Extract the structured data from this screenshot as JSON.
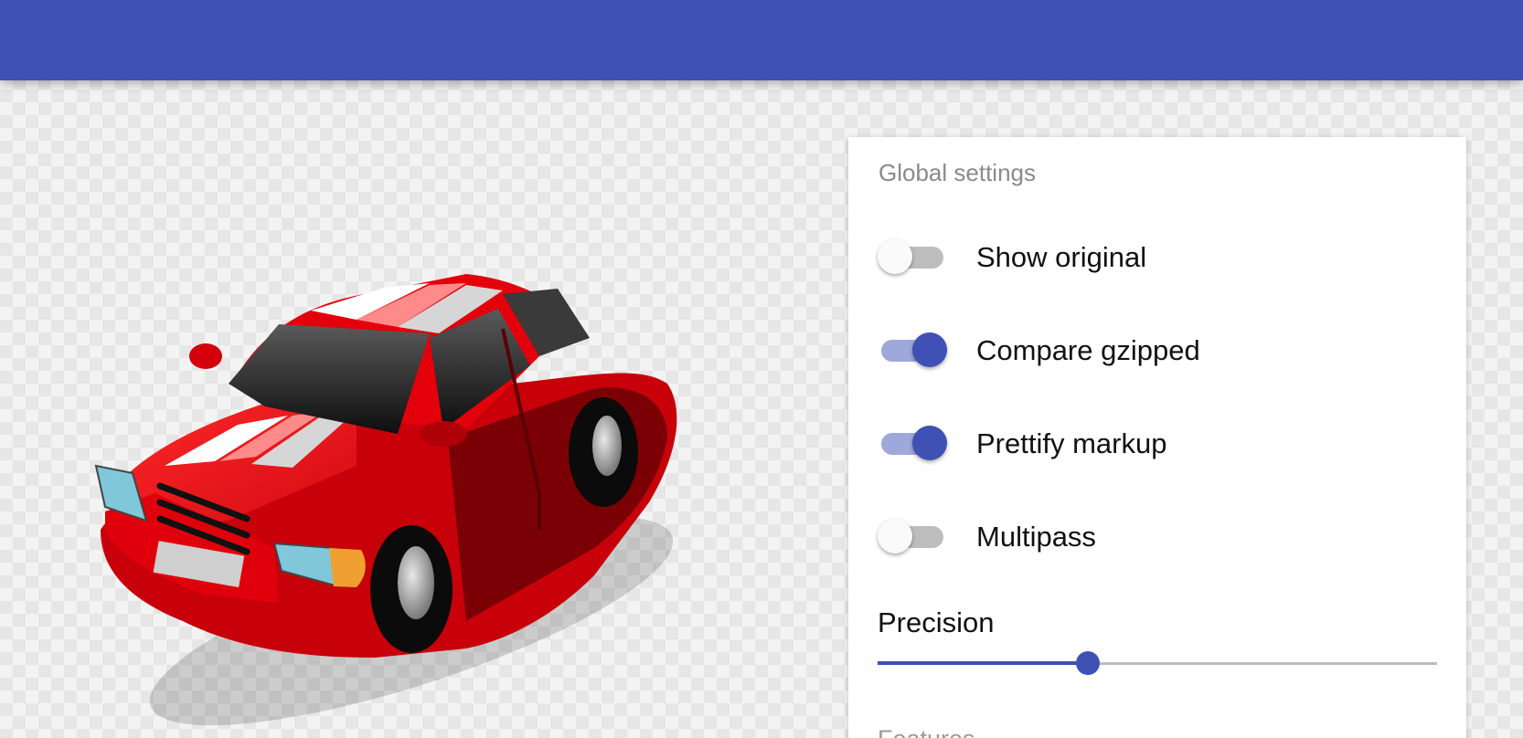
{
  "colors": {
    "primary": "#3f51b5",
    "primary_light": "#9fa8da",
    "toggle_off_track": "#bdbdbd",
    "toggle_off_thumb": "#fafafa"
  },
  "preview": {
    "image_icon": "red-car-illustration"
  },
  "settings": {
    "title": "Global settings",
    "options": [
      {
        "label": "Show original",
        "enabled": false
      },
      {
        "label": "Compare gzipped",
        "enabled": true
      },
      {
        "label": "Prettify markup",
        "enabled": true
      },
      {
        "label": "Multipass",
        "enabled": false
      }
    ],
    "precision": {
      "label": "Precision",
      "fraction": 0.375
    },
    "next_section_label": "Features"
  }
}
